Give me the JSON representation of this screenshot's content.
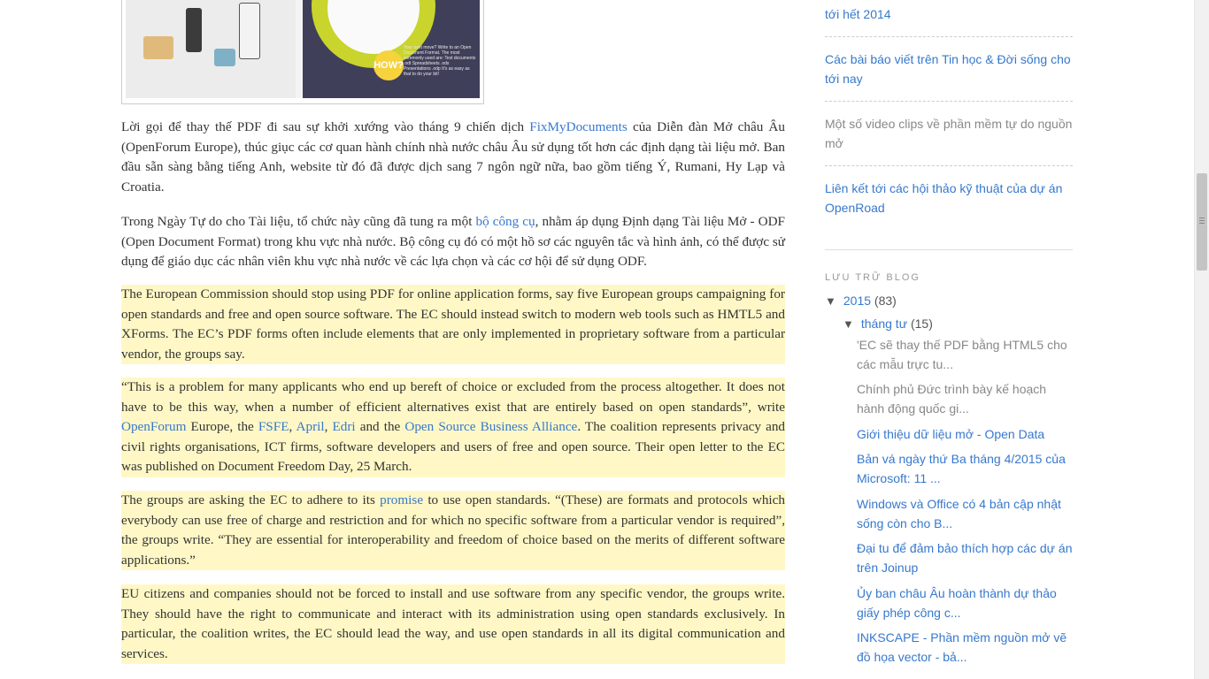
{
  "image": {
    "alt": "Infographic: FixMyDocuments",
    "caption": "Your next move? Write to an Open Document Format. The most commonly used are: Text documents .odt Spreadsheets .ods Presentations .odp It's as easy as that to do your bit!",
    "how_label": "HOW?"
  },
  "article": {
    "p1": {
      "before": "Lời gọi để thay thế PDF đi sau sự khởi xướng vào tháng 9 chiến dịch ",
      "link": "FixMyDocuments",
      "after": " của Diễn đàn Mở châu Âu (OpenForum Europe), thúc giục các cơ quan hành chính nhà nước châu Âu sử dụng tốt hơn các định dạng tài liệu mở. Ban đầu sẵn sàng bằng tiếng Anh, website từ đó đã được dịch sang 7 ngôn ngữ nữa, bao gồm tiếng Ý, Rumani, Hy Lạp và Croatia."
    },
    "p2": {
      "before": "Trong Ngày Tự do cho Tài liệu, tổ chức này cũng đã tung ra một ",
      "link": "bộ công cụ",
      "after": ", nhằm áp dụng Định dạng Tài liệu Mở - ODF (Open Document Format) trong khu vực nhà nước. Bộ công cụ đó có một hồ sơ các nguyên tắc và hình ảnh, có thể được sử dụng để giáo dục các nhân viên khu vực nhà nước về các lựa chọn và các cơ hội để sử dụng ODF."
    },
    "p3": "The European Commission should stop using PDF for online application forms, say five European groups campaigning for open standards and free and open source software. The EC should instead switch to modern web tools such as HMTL5 and XForms. The EC’s PDF forms often include elements that are only implemented in proprietary software from a particular vendor, the groups say.",
    "p4": {
      "t1": "“This is a problem for many applicants who end up bereft of choice or excluded from the process altogether. It does not have to be this way, when a number of efficient alternatives exist that are entirely based on open standards”, write ",
      "l1": "OpenForum",
      "t2": " Europe, the ",
      "l2": "FSFE",
      "t3": ", ",
      "l3": "April",
      "t4": ", ",
      "l4": "Edri",
      "t5": " and the ",
      "l5": "Open Source Business Alliance",
      "t6": ". The coalition represents privacy and civil rights organisations, ICT firms, software developers and users of free and open source. Their open letter to the EC was published on Document Freedom Day, 25 March."
    },
    "p5": {
      "before": "The groups are asking the EC to adhere to its ",
      "link": "promise",
      "after": " to use open standards. “(These) are formats and protocols which everybody can use free of charge and restriction and for which no specific software from a particular vendor is required”, the groups write. “They are essential for interoperability and freedom of choice based on the merits of different software applications.”"
    },
    "p6": "EU citizens and companies should not be forced to install and use software from any specific vendor, the groups write. They should have the right to communicate and interact with its administration using open standards exclusively. In particular, the coalition writes, the EC should lead the way, and use open standards in all its digital communication and services."
  },
  "sidebar": {
    "links": [
      {
        "label": "tới hết 2014"
      },
      {
        "label": "Các bài báo viết trên Tin học & Đời sống cho tới nay"
      },
      {
        "label": "Một số video clips về phần mềm tự do nguồn mở"
      },
      {
        "label": "Liên kết tới các hội thảo kỹ thuật của dự án OpenRoad"
      }
    ],
    "archive": {
      "title": "LƯU TRỮ BLOG",
      "year": {
        "label": "2015",
        "count": "(83)"
      },
      "month": {
        "label": "tháng tư",
        "count": "(15)"
      },
      "posts": [
        {
          "label": "'EC sẽ thay thế PDF bằng HTML5 cho các mẫu trực tu..."
        },
        {
          "label": "Chính phủ Đức trình bày kế hoạch hành động quốc gi..."
        },
        {
          "label": "Giới thiệu dữ liệu mở - Open Data"
        },
        {
          "label": "Bản vá ngày thứ Ba tháng 4/2015 của Microsoft: 11 ..."
        },
        {
          "label": "Windows và Office có 4 bản cập nhật sống còn cho B..."
        },
        {
          "label": "Đại tu để đảm bảo thích hợp các dự án trên Joinup"
        },
        {
          "label": "Ủy ban châu Âu hoàn thành dự thảo giấy phép công c..."
        },
        {
          "label": "INKSCAPE - Phần mềm nguồn mở vẽ đồ họa vector - bả..."
        }
      ]
    }
  }
}
